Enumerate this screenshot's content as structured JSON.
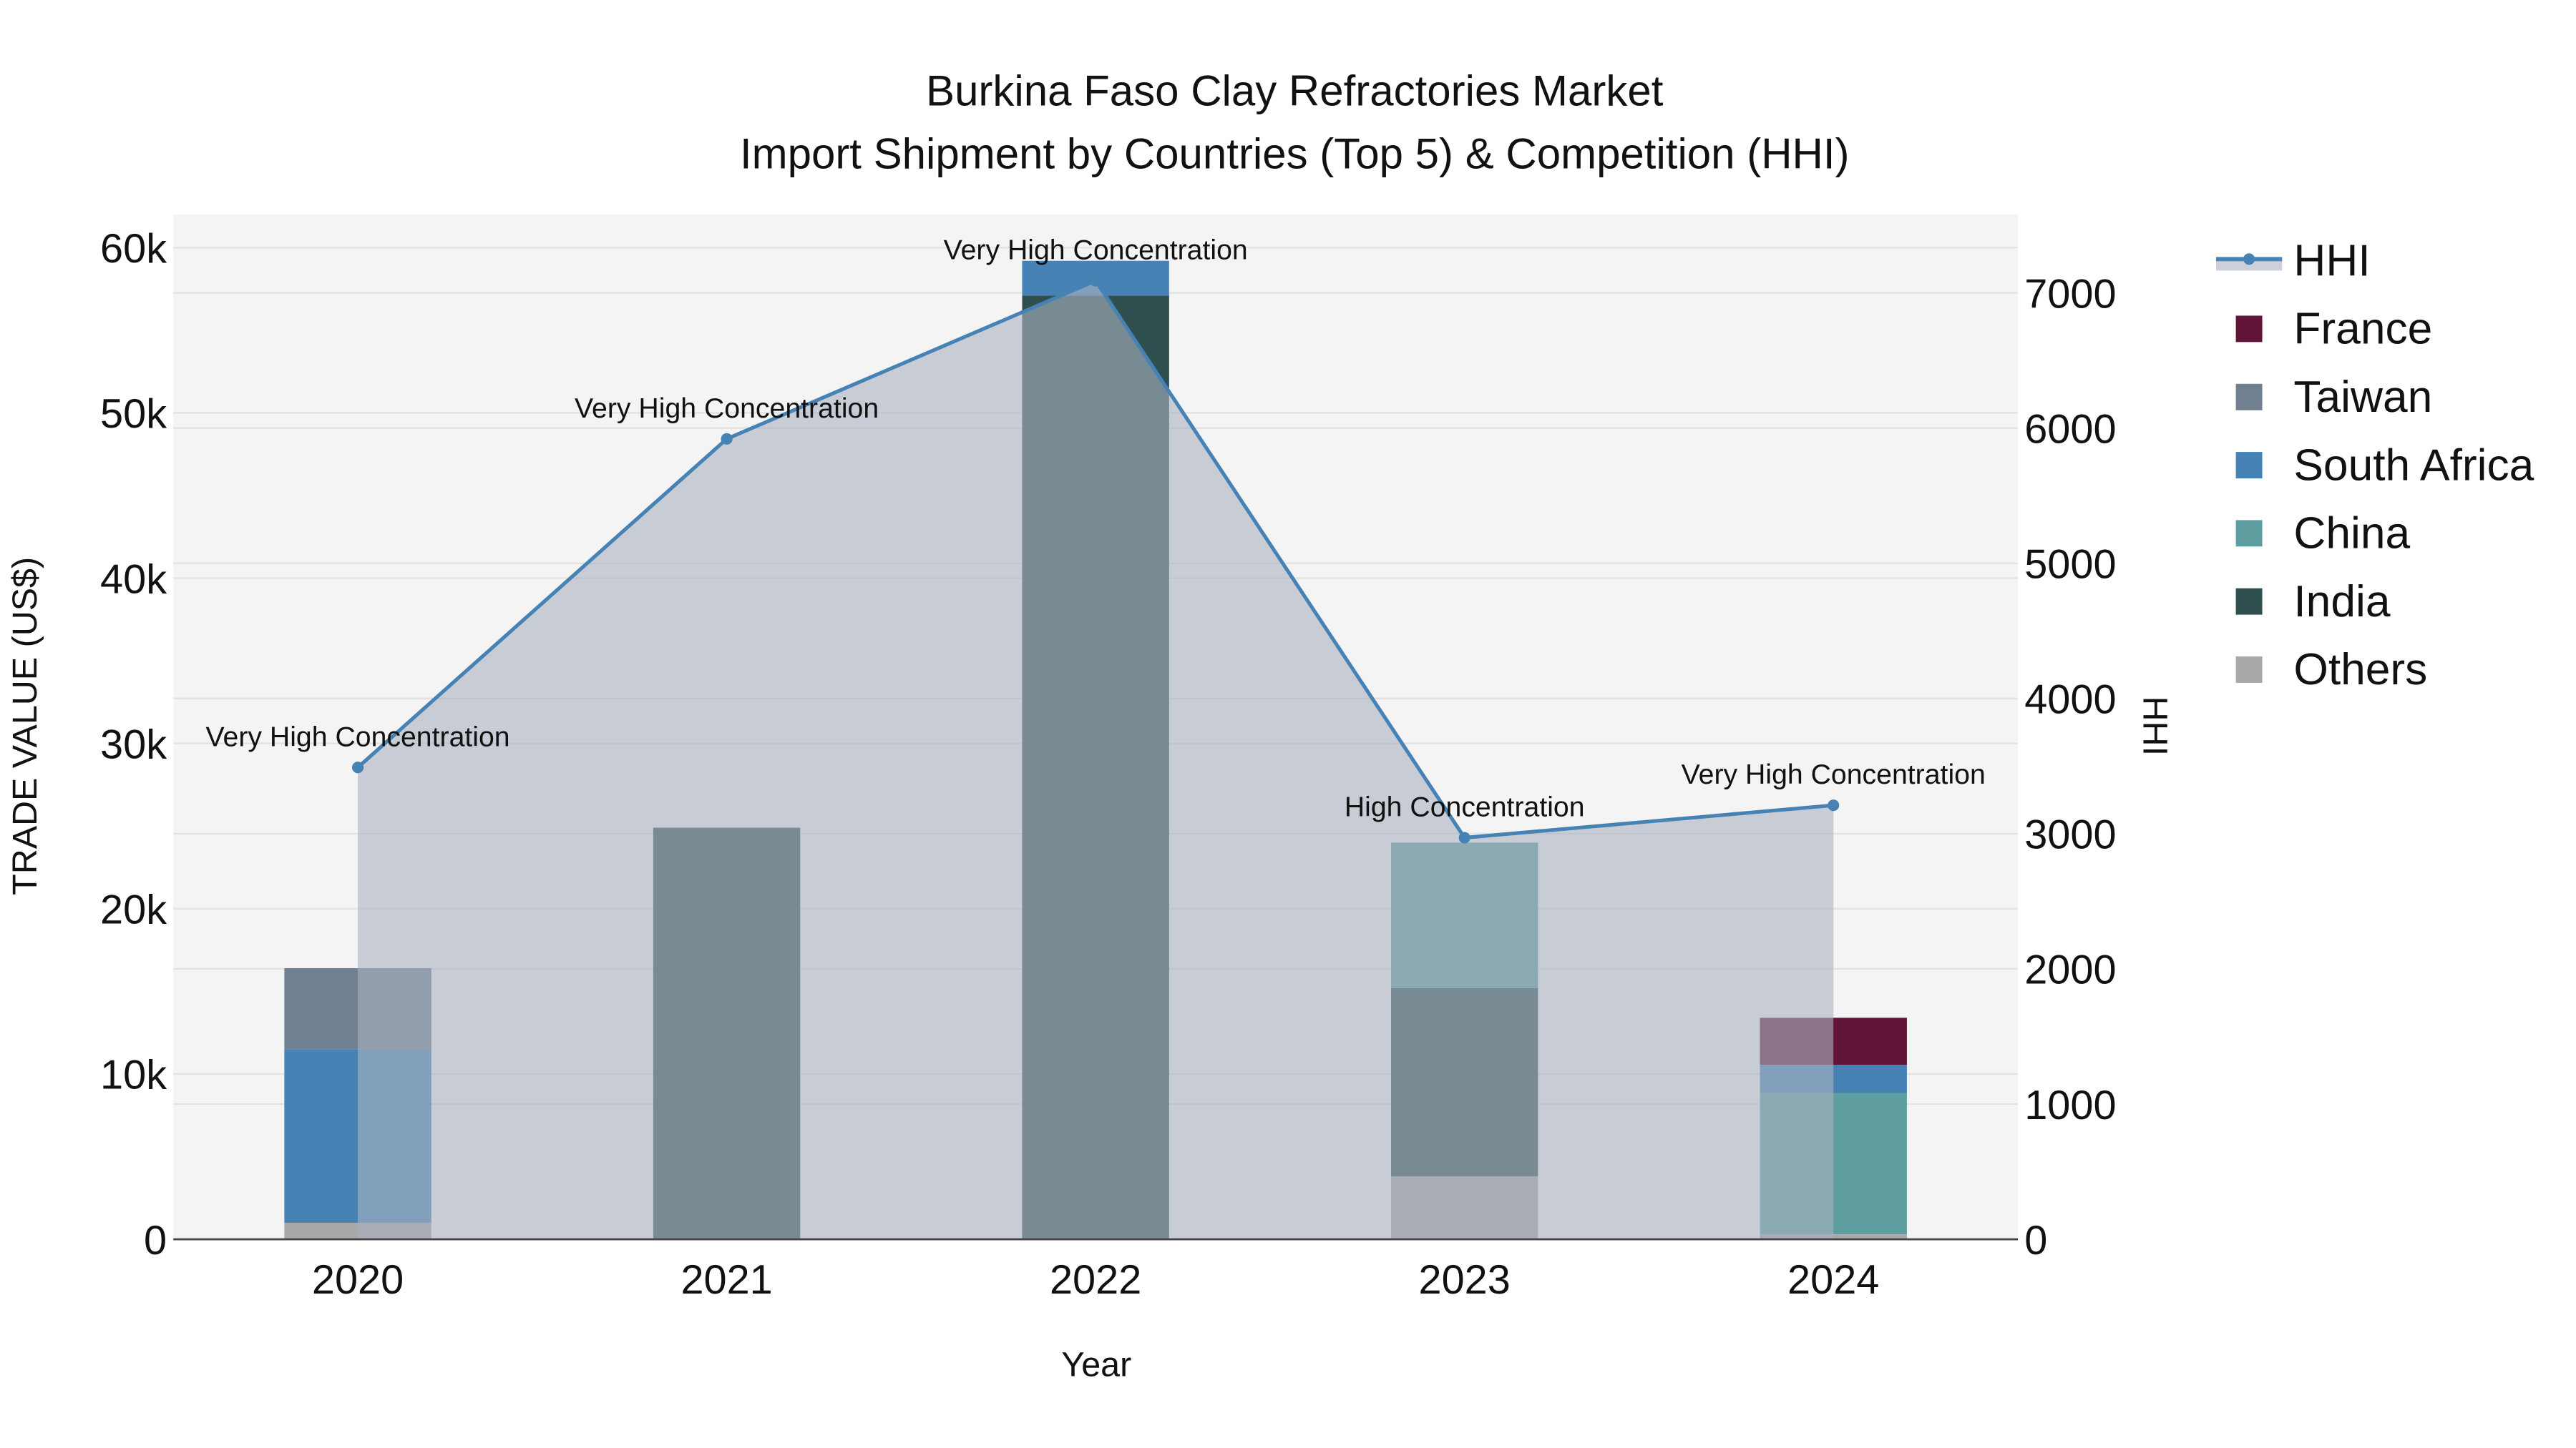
{
  "chart_data": {
    "type": "bar",
    "title": "Burkina Faso Clay Refractories Market",
    "subtitle": "Import Shipment by Countries (Top 5) & Competition (HHI)",
    "xlabel": "Year",
    "ylabel": "TRADE VALUE (US$)",
    "y2label": "HHI",
    "categories": [
      "2020",
      "2021",
      "2022",
      "2023",
      "2024"
    ],
    "ylim": [
      0,
      62000
    ],
    "y_ticks": [
      0,
      10000,
      20000,
      30000,
      40000,
      50000,
      60000
    ],
    "y_tick_labels": [
      "0",
      "10k",
      "20k",
      "30k",
      "40k",
      "50k",
      "60k"
    ],
    "y2lim": [
      0,
      7580
    ],
    "y2_ticks": [
      0,
      1000,
      2000,
      3000,
      4000,
      5000,
      6000,
      7000
    ],
    "y2_tick_labels": [
      "0",
      "1000",
      "2000",
      "3000",
      "4000",
      "5000",
      "6000",
      "7000"
    ],
    "stacked": true,
    "grid": true,
    "legend_position": "right",
    "series": [
      {
        "name": "Others",
        "color": "#A9A9A9",
        "values": [
          1000,
          0,
          0,
          3800,
          300
        ]
      },
      {
        "name": "India",
        "color": "#2F4F4F",
        "values": [
          0,
          24900,
          57100,
          11400,
          0
        ]
      },
      {
        "name": "China",
        "color": "#5F9EA0",
        "values": [
          0,
          0,
          0,
          8800,
          8550
        ]
      },
      {
        "name": "South Africa",
        "color": "#4682B4",
        "values": [
          10500,
          0,
          2100,
          0,
          1700
        ]
      },
      {
        "name": "Taiwan",
        "color": "#708090",
        "values": [
          4900,
          0,
          0,
          0,
          0
        ]
      },
      {
        "name": "France",
        "color": "#601437",
        "values": [
          0,
          0,
          0,
          0,
          2850
        ]
      }
    ],
    "legend_order": [
      "HHI",
      "France",
      "Taiwan",
      "South Africa",
      "China",
      "India",
      "Others"
    ],
    "hhi": {
      "name": "HHI",
      "color": "#4682B4",
      "values": [
        3490,
        5920,
        7090,
        2970,
        3210
      ],
      "annotations": [
        "Very High Concentration",
        "Very High Concentration",
        "Very High Concentration",
        "High Concentration",
        "Very High Concentration"
      ]
    }
  }
}
